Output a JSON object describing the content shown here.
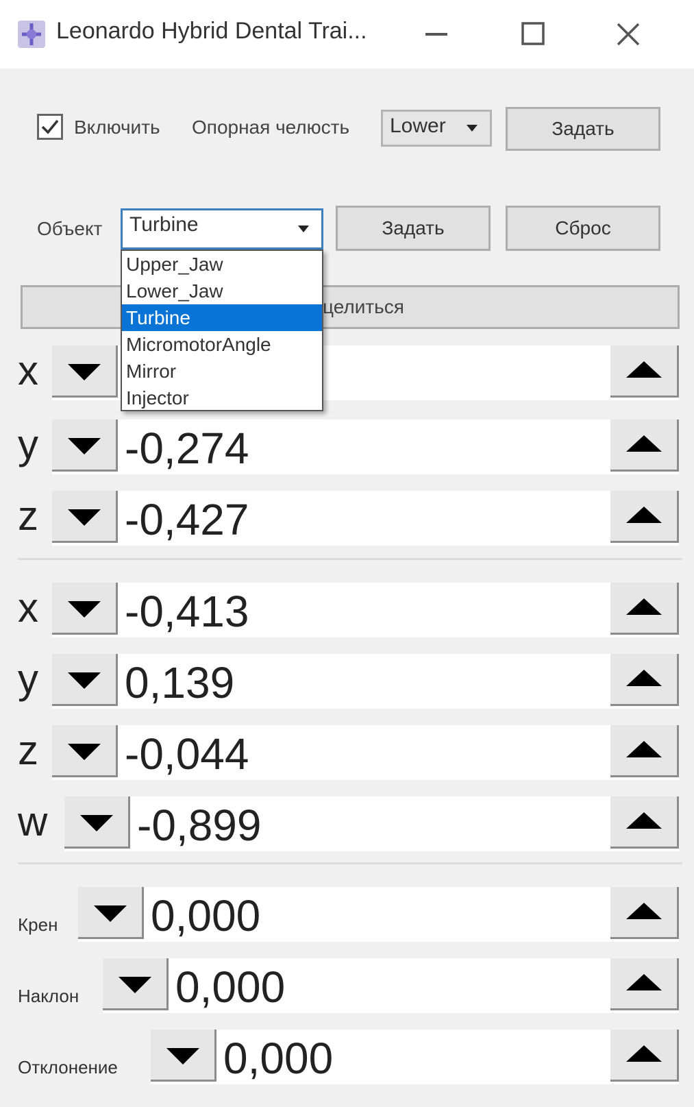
{
  "window": {
    "title": "Leonardo Hybrid Dental Trai...",
    "controls": {
      "minimize": "—",
      "maximize": "☐",
      "close": "✕"
    }
  },
  "top": {
    "enable_checked": true,
    "enable_label": "Включить",
    "jaw_label": "Опорная челюсть",
    "jaw_value": "Lower",
    "set_label": "Задать"
  },
  "object": {
    "label": "Объект",
    "value": "Turbine",
    "set_label": "Задать",
    "reset_label": "Сброс",
    "options": [
      "Upper_Jaw",
      "Lower_Jaw",
      "Turbine",
      "MicromotorAngle",
      "Mirror",
      "Injector"
    ],
    "selected_index": 2,
    "hidden_button_text": "целиться"
  },
  "position": [
    {
      "axis": "x",
      "value": ""
    },
    {
      "axis": "y",
      "value": "-0,274"
    },
    {
      "axis": "z",
      "value": "-0,427"
    }
  ],
  "rotation": [
    {
      "axis": "x",
      "value": "-0,413"
    },
    {
      "axis": "y",
      "value": "0,139"
    },
    {
      "axis": "z",
      "value": "-0,044"
    },
    {
      "axis": "w",
      "value": "-0,899"
    }
  ],
  "euler": [
    {
      "axis": "Крен",
      "value": "0,000"
    },
    {
      "axis": "Наклон",
      "value": "0,000"
    },
    {
      "axis": "Отклонение",
      "value": "0,000"
    }
  ]
}
